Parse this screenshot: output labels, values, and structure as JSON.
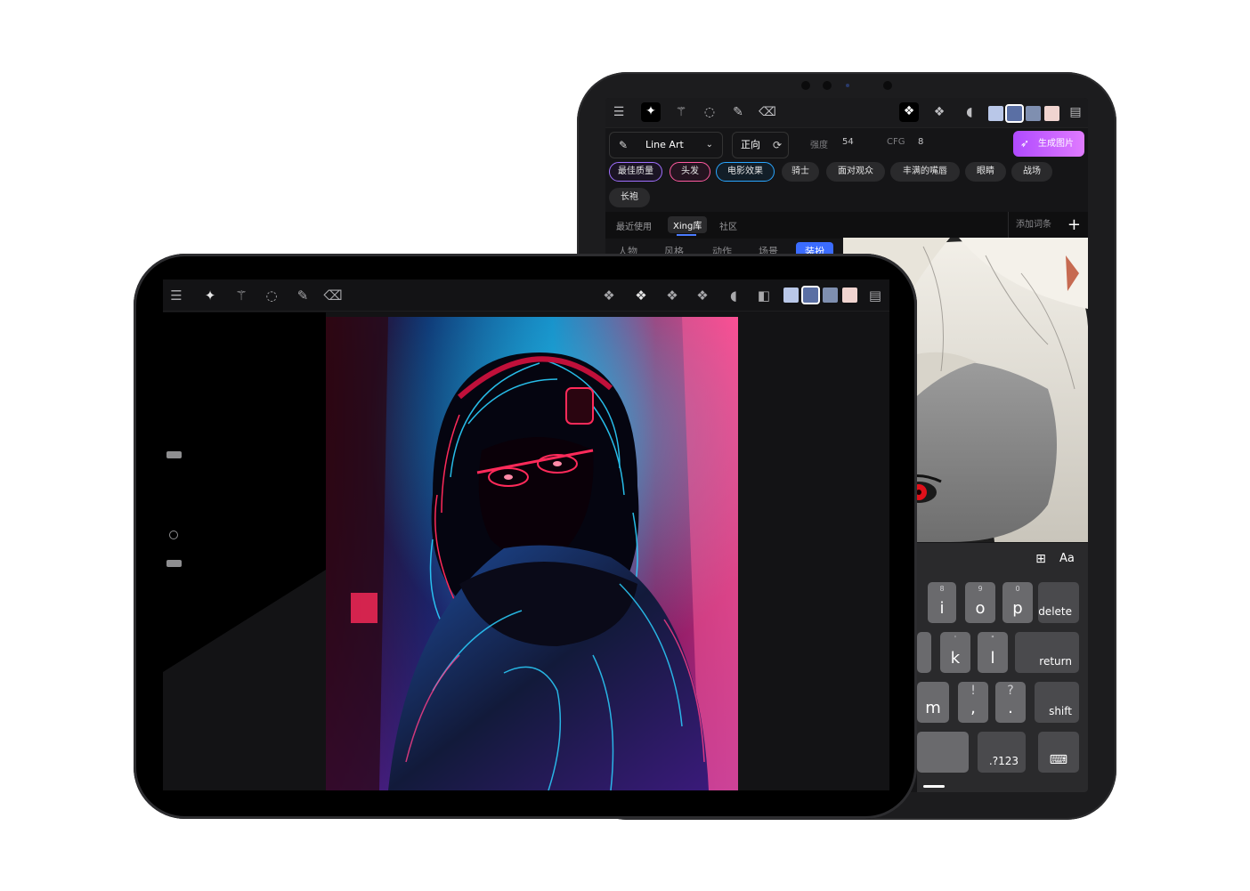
{
  "back_tablet": {
    "toolbar": {
      "icons": [
        "menu-icon",
        "sparkle-icon",
        "magic-wand-icon",
        "lasso-icon",
        "brush-icon",
        "eraser-icon",
        "stamp-icon",
        "stamp-alt-icon",
        "leaf-icon",
        "layers-icon"
      ],
      "swatches": [
        "#b9c7e8",
        "#5a6fa4",
        "#7f8fb0",
        "#f0d4d0"
      ]
    },
    "controls": {
      "model": "Line Art",
      "direction": "正向",
      "strength_label": "强度",
      "strength_value": "54",
      "cfg_label": "CFG",
      "cfg_value": "8",
      "generate_label": "生成图片"
    },
    "tags": [
      "最佳质量",
      "头发",
      "电影效果",
      "骑士",
      "面对观众",
      "丰满的嘴唇",
      "眼睛",
      "战场",
      "长袍"
    ],
    "library_tabs": [
      "最近使用",
      "Xing库",
      "社区"
    ],
    "add_word_label": "添加词条",
    "categories": [
      "人物",
      "风格",
      "动作",
      "场景",
      "装扮"
    ],
    "keyboard": {
      "top_icons": [
        "table-icon"
      ],
      "top_text": "Aa",
      "rows": [
        [
          {
            "sup": "8",
            "k": "i"
          },
          {
            "sup": "9",
            "k": "o"
          },
          {
            "sup": "0",
            "k": "p"
          }
        ],
        [
          {
            "sup": "'",
            "k": "k"
          },
          {
            "sup": "\"",
            "k": "l"
          }
        ],
        [
          {
            "sup": "",
            "k": "m"
          },
          {
            "sup": "!",
            "k": ","
          },
          {
            "sup": "?",
            "k": "."
          }
        ]
      ],
      "delete_label": "delete",
      "return_label": "return",
      "shift_label": "shift",
      "numbers_label": ".?123"
    }
  },
  "front_tablet": {
    "toolbar": {
      "icons": [
        "menu-icon",
        "sparkle-icon",
        "magic-wand-icon",
        "lasso-icon",
        "brush-icon",
        "eraser-icon",
        "stamp-icon",
        "stamp-alt-icon",
        "stamp-alt2-icon",
        "stamp-alt3-icon",
        "leaf-icon",
        "layers-icon"
      ],
      "swatches": [
        "#b9c7e8",
        "#5a6fa4",
        "#7f8fb0",
        "#f0d4d0"
      ]
    }
  }
}
